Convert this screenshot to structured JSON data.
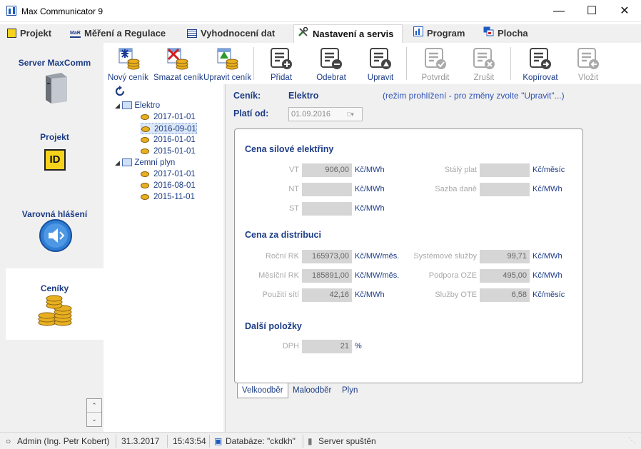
{
  "window": {
    "title": "Max Communicator 9"
  },
  "menu": [
    {
      "label": "Projekt",
      "icon": "project-icon"
    },
    {
      "label": "Měření a Regulace",
      "icon": "mar-icon"
    },
    {
      "label": "Vyhodnocení dat",
      "icon": "table-icon"
    },
    {
      "label": "Nastavení a servis",
      "icon": "tools-icon"
    },
    {
      "label": "Program",
      "icon": "chart-icon"
    },
    {
      "label": "Plocha",
      "icon": "desktop-icon"
    }
  ],
  "left_panel": [
    {
      "label": "Server MaxComm"
    },
    {
      "label": "Projekt"
    },
    {
      "label": "Varovná hlášení"
    },
    {
      "label": "Ceníky"
    }
  ],
  "toolbar": [
    {
      "label": "Nový ceník"
    },
    {
      "label": "Smazat ceník"
    },
    {
      "label": "Upravit ceník"
    },
    {
      "label": "Přidat"
    },
    {
      "label": "Odebrat"
    },
    {
      "label": "Upravit"
    },
    {
      "label": "Potvrdit"
    },
    {
      "label": "Zrušit"
    },
    {
      "label": "Kopírovat"
    },
    {
      "label": "Vložit"
    }
  ],
  "tree": {
    "groups": [
      {
        "label": "Elektro",
        "dates": [
          "2017-01-01",
          "2016-09-01",
          "2016-01-01",
          "2015-01-01"
        ]
      },
      {
        "label": "Zemní plyn",
        "dates": [
          "2017-01-01",
          "2016-08-01",
          "2015-11-01"
        ]
      }
    ]
  },
  "content": {
    "pricelist_label": "Ceník:",
    "pricelist_value": "Elektro",
    "mode_note": "(režim prohlížení - pro změny zvolte \"Upravit\"...)",
    "valid_label": "Platí od:",
    "valid_value": "01.09.2016"
  },
  "sections": {
    "power": {
      "title": "Cena silové elektřiny",
      "fields": [
        {
          "label": "VT",
          "value": "906,00",
          "unit": "Kč/MWh"
        },
        {
          "label": "NT",
          "value": "",
          "unit": "Kč/MWh"
        },
        {
          "label": "ST",
          "value": "",
          "unit": "Kč/MWh"
        },
        {
          "label": "Stálý plat",
          "value": "",
          "unit": "Kč/měsíc"
        },
        {
          "label": "Sazba daně",
          "value": "",
          "unit": "Kč/MWh"
        }
      ]
    },
    "distribution": {
      "title": "Cena za distribuci",
      "fields": [
        {
          "label": "Roční RK",
          "value": "165973,00",
          "unit": "Kč/MW/měs."
        },
        {
          "label": "Měsíční RK",
          "value": "185891,00",
          "unit": "Kč/MW/měs."
        },
        {
          "label": "Použití sítí",
          "value": "42,16",
          "unit": "Kč/MWh"
        },
        {
          "label": "Systémové služby",
          "value": "99,71",
          "unit": "Kč/MWh"
        },
        {
          "label": "Podpora OZE",
          "value": "495,00",
          "unit": "Kč/MWh"
        },
        {
          "label": "Služby OTE",
          "value": "6,58",
          "unit": "Kč/měsíc"
        }
      ]
    },
    "other": {
      "title": "Další položky",
      "fields": [
        {
          "label": "DPH",
          "value": "21",
          "unit": "%"
        }
      ]
    }
  },
  "tabs": [
    "Velkoodběr",
    "Maloodběr",
    "Plyn"
  ],
  "status": {
    "user": "Admin (Ing. Petr Kobert)",
    "date": "31.3.2017",
    "time": "15:43:54",
    "database": "Databáze: \"ckdkh\"",
    "server": "Server spuštěn"
  },
  "colors": {
    "accent": "#1c3c86",
    "active_tab_bg": "#ffffff",
    "field_bg": "#d6d6d6"
  }
}
